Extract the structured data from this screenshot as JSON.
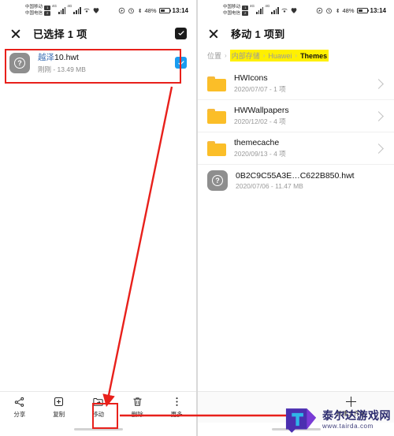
{
  "status_bar": {
    "carrier_1": "中国移动",
    "carrier_2": "中国电信",
    "net_1": "4G",
    "net_2": "4G",
    "battery_percent": "48%",
    "time": "13:14",
    "icons": [
      "location-icon",
      "alarm-icon",
      "bluetooth-icon",
      "wifi-icon",
      "vpn-icon"
    ]
  },
  "left_panel": {
    "title": "已选择 1 项",
    "close_label": "关闭",
    "select_all_label": "全选",
    "file": {
      "name_highlight": "越泽",
      "name_rest": "10.hwt",
      "full_name": "越泽10.hwt",
      "meta": "刚刚 - 13.49 MB",
      "icon": "unknown-file-icon",
      "checked": true
    },
    "toolbar": [
      {
        "label": "分享",
        "icon": "share-icon"
      },
      {
        "label": "复制",
        "icon": "copy-icon"
      },
      {
        "label": "移动",
        "icon": "move-icon"
      },
      {
        "label": "删除",
        "icon": "trash-icon"
      },
      {
        "label": "更多",
        "icon": "more-icon"
      }
    ]
  },
  "right_panel": {
    "title": "移动 1 项到",
    "breadcrumb": {
      "root": "位置",
      "items": [
        "内部存储",
        "Huawei",
        "Themes"
      ],
      "separator": "›",
      "highlight_color": "#fff000"
    },
    "list": [
      {
        "name": "HWIcons",
        "meta": "2020/07/07 - 1 项",
        "type": "folder"
      },
      {
        "name": "HWWallpapers",
        "meta": "2020/12/02 - 4 项",
        "type": "folder"
      },
      {
        "name": "themecache",
        "meta": "2020/09/13 - 4 项",
        "type": "folder"
      },
      {
        "name": "0B2C9C55A3E…C622B850.hwt",
        "meta": "2020/07/06 - 11.47 MB",
        "type": "file"
      }
    ],
    "new_folder_label": "新建文件夹"
  },
  "annotations": {
    "accent_color": "#e8201b",
    "file_highlight_box": "选中文件高亮框",
    "move_button_box": "移动按钮高亮框"
  },
  "watermark": {
    "name": "泰尔达游戏网",
    "url": "www.tairda.com"
  }
}
